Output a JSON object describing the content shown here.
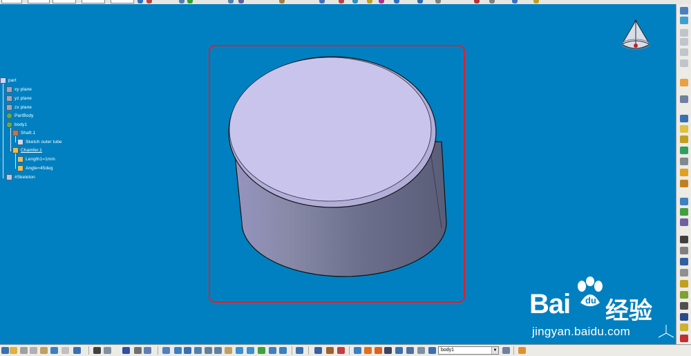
{
  "tree": {
    "root": "part",
    "items": [
      {
        "label": "xy plane"
      },
      {
        "label": "yz plane"
      },
      {
        "label": "zx plane"
      },
      {
        "label": "PartBody"
      },
      {
        "label": "body1"
      },
      {
        "label": "Shaft.1"
      },
      {
        "label": "Sketch outer tube"
      },
      {
        "label": "Chamfer.1"
      },
      {
        "label": "Length1=1mm"
      },
      {
        "label": "Angle=45deg"
      },
      {
        "label": "#Skeleton"
      }
    ]
  },
  "toolbar": {
    "current_body": "body1"
  },
  "watermark": {
    "brand_latin": "Bai",
    "brand_du": "du",
    "brand_cn": "经验",
    "url": "jingyan.baidu.com"
  },
  "colors": {
    "viewport_bg": "#0080c0",
    "highlight_box": "#e0202a",
    "cylinder_top": "#c8c4ec",
    "cylinder_side": "#6a6e8a"
  }
}
